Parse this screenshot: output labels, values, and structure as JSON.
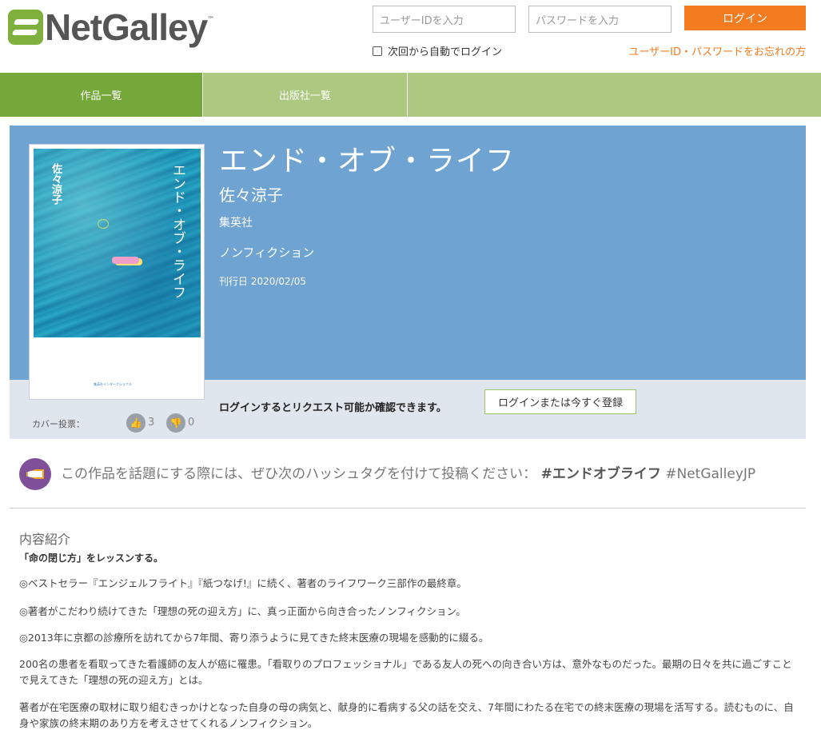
{
  "header": {
    "logo_text": "NetGalley",
    "logo_tm": "™",
    "user_placeholder": "ユーザーIDを入力",
    "password_placeholder": "パスワードを入力",
    "login_button": "ログイン",
    "remember_label": "次回から自動でログイン",
    "forgot_link": "ユーザーID・パスワードをお忘れの方"
  },
  "nav": {
    "items": [
      {
        "label": "作品一覧",
        "active": true
      },
      {
        "label": "出版社一覧",
        "active": false
      }
    ]
  },
  "book": {
    "title": "エンド・オブ・ライフ",
    "author": "佐々涼子",
    "publisher": "集英社",
    "genre": "ノンフィクション",
    "release_label": "刊行日",
    "release_date": "2020/02/05",
    "cover": {
      "title": "エンド・オブ・ライフ",
      "author": "佐々涼子",
      "publisher_small": "集英社インターナショナル"
    }
  },
  "request": {
    "message": "ログインするとリクエスト可能か確認できます。",
    "register_button": "ログインまたは今すぐ登録"
  },
  "votes": {
    "label": "カバー投票：",
    "up_count": "3",
    "down_count": "0"
  },
  "hashtag": {
    "text": "この作品を話題にする際には、ぜひ次のハッシュタグを付けて投稿ください：",
    "tag1": "#エンドオブライフ",
    "tag2": "#NetGalleyJP"
  },
  "description": {
    "heading": "内容紹介",
    "lead": "「命の閉じ方」をレッスンする。",
    "paragraphs": [
      "◎ベストセラー『エンジェルフライト』『紙つなげ!』に続く、著者のライフワーク三部作の最終章。",
      "◎著者がこだわり続けてきた「理想の死の迎え方」に、真っ正面から向き合ったノンフィクション。",
      "◎2013年に京都の診療所を訪れてから7年間、寄り添うように見てきた終末医療の現場を感動的に綴る。",
      "200名の患者を看取ってきた看護師の友人が癌に罹患。「看取りのプロフェッショナル」である友人の死への向き合い方は、意外なものだった。最期の日々を共に過ごすことで見えてきた「理想の死の迎え方」とは。",
      "著者が在宅医療の取材に取り組むきっかけとなった自身の母の病気と、献身的に看病する父の話を交え、7年間にわたる在宅での終末医療の現場を活写する。読むものに、自身や家族の終末期のあり方を考えさせてくれるノンフィクション。"
    ]
  },
  "colors": {
    "brand_green": "#74a83a",
    "nav_green": "#adc87f",
    "orange": "#f37b20",
    "hero_blue": "#6fa3d1",
    "purple": "#7f4f9a"
  }
}
